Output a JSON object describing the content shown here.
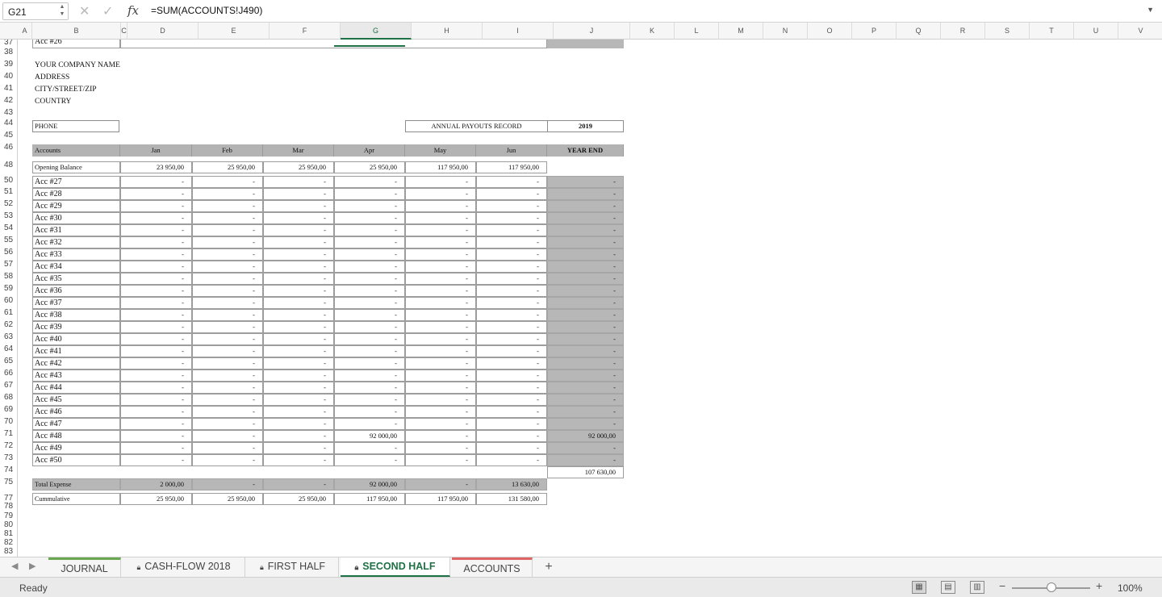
{
  "formula_bar": {
    "name_box": "G21",
    "cancel_icon": "✕",
    "enter_icon": "✓",
    "fx": "fx",
    "formula": "=SUM(ACCOUNTS!J490)",
    "expand_icon": "▼"
  },
  "columns": [
    "A",
    "B",
    "C",
    "D",
    "E",
    "F",
    "G",
    "H",
    "I",
    "J",
    "K",
    "L",
    "M",
    "N",
    "O",
    "P",
    "Q",
    "R",
    "S",
    "T",
    "U",
    "V"
  ],
  "selected_column": "G",
  "rows": [
    "37",
    "38",
    "39",
    "40",
    "41",
    "42",
    "43",
    "44",
    "45",
    "46",
    "",
    "48",
    "",
    "50",
    "51",
    "52",
    "53",
    "54",
    "55",
    "56",
    "57",
    "58",
    "59",
    "60",
    "61",
    "62",
    "63",
    "64",
    "65",
    "66",
    "67",
    "68",
    "69",
    "70",
    "71",
    "72",
    "73",
    "74",
    "75",
    "",
    "77",
    "78",
    "79",
    "80",
    "81",
    "82",
    "83"
  ],
  "sheet": {
    "top_row_label": "Acc #26",
    "company": [
      "YOUR COMPANY NAME",
      "ADDRESS",
      "CITY/STREET/ZIP",
      "COUNTRY"
    ],
    "phone_label": "PHONE",
    "record_title": "ANNUAL PAYOUTS RECORD",
    "year": "2019",
    "header": [
      "Accounts",
      "Jan",
      "Feb",
      "Mar",
      "Apr",
      "May",
      "Jun",
      "YEAR END"
    ],
    "opening_balance": {
      "label": "Opening Balance",
      "values": [
        "23 950,00",
        "25 950,00",
        "25 950,00",
        "25 950,00",
        "117 950,00",
        "117 950,00"
      ]
    },
    "accounts": [
      {
        "label": "Acc #27",
        "values": [
          "-",
          "-",
          "-",
          "-",
          "-",
          "-",
          "-"
        ]
      },
      {
        "label": "Acc #28",
        "values": [
          "-",
          "-",
          "-",
          "-",
          "-",
          "-",
          "-"
        ]
      },
      {
        "label": "Acc #29",
        "values": [
          "-",
          "-",
          "-",
          "-",
          "-",
          "-",
          "-"
        ]
      },
      {
        "label": "Acc #30",
        "values": [
          "-",
          "-",
          "-",
          "-",
          "-",
          "-",
          "-"
        ]
      },
      {
        "label": "Acc #31",
        "values": [
          "-",
          "-",
          "-",
          "-",
          "-",
          "-",
          "-"
        ]
      },
      {
        "label": "Acc #32",
        "values": [
          "-",
          "-",
          "-",
          "-",
          "-",
          "-",
          "-"
        ]
      },
      {
        "label": "Acc #33",
        "values": [
          "-",
          "-",
          "-",
          "-",
          "-",
          "-",
          "-"
        ]
      },
      {
        "label": "Acc #34",
        "values": [
          "-",
          "-",
          "-",
          "-",
          "-",
          "-",
          "-"
        ]
      },
      {
        "label": "Acc #35",
        "values": [
          "-",
          "-",
          "-",
          "-",
          "-",
          "-",
          "-"
        ]
      },
      {
        "label": "Acc #36",
        "values": [
          "-",
          "-",
          "-",
          "-",
          "-",
          "-",
          "-"
        ]
      },
      {
        "label": "Acc #37",
        "values": [
          "-",
          "-",
          "-",
          "-",
          "-",
          "-",
          "-"
        ]
      },
      {
        "label": "Acc #38",
        "values": [
          "-",
          "-",
          "-",
          "-",
          "-",
          "-",
          "-"
        ]
      },
      {
        "label": "Acc #39",
        "values": [
          "-",
          "-",
          "-",
          "-",
          "-",
          "-",
          "-"
        ]
      },
      {
        "label": "Acc #40",
        "values": [
          "-",
          "-",
          "-",
          "-",
          "-",
          "-",
          "-"
        ]
      },
      {
        "label": "Acc #41",
        "values": [
          "-",
          "-",
          "-",
          "-",
          "-",
          "-",
          "-"
        ]
      },
      {
        "label": "Acc #42",
        "values": [
          "-",
          "-",
          "-",
          "-",
          "-",
          "-",
          "-"
        ]
      },
      {
        "label": "Acc #43",
        "values": [
          "-",
          "-",
          "-",
          "-",
          "-",
          "-",
          "-"
        ]
      },
      {
        "label": "Acc #44",
        "values": [
          "-",
          "-",
          "-",
          "-",
          "-",
          "-",
          "-"
        ]
      },
      {
        "label": "Acc #45",
        "values": [
          "-",
          "-",
          "-",
          "-",
          "-",
          "-",
          "-"
        ]
      },
      {
        "label": "Acc #46",
        "values": [
          "-",
          "-",
          "-",
          "-",
          "-",
          "-",
          "-"
        ]
      },
      {
        "label": "Acc #47",
        "values": [
          "-",
          "-",
          "-",
          "-",
          "-",
          "-",
          "-"
        ]
      },
      {
        "label": "Acc #48",
        "values": [
          "-",
          "-",
          "-",
          "92 000,00",
          "-",
          "-",
          "92 000,00"
        ]
      },
      {
        "label": "Acc #49",
        "values": [
          "-",
          "-",
          "-",
          "-",
          "-",
          "-",
          "-"
        ]
      },
      {
        "label": "Acc #50",
        "values": [
          "-",
          "-",
          "-",
          "-",
          "-",
          "-",
          "-"
        ]
      }
    ],
    "year_end_total": "107 630,00",
    "total_expense": {
      "label": "Total Expense",
      "values": [
        "2 000,00",
        "-",
        "-",
        "92 000,00",
        "-",
        "13 630,00"
      ]
    },
    "cumulative": {
      "label": "Cummulative",
      "values": [
        "25 950,00",
        "25 950,00",
        "25 950,00",
        "117 950,00",
        "117 950,00",
        "131 580,00"
      ]
    }
  },
  "tabs": [
    {
      "label": "JOURNAL",
      "locked": false,
      "active": false,
      "accent": "#6aa84f"
    },
    {
      "label": "CASH-FLOW 2018",
      "locked": true,
      "active": false,
      "accent": ""
    },
    {
      "label": "FIRST HALF",
      "locked": true,
      "active": false,
      "accent": ""
    },
    {
      "label": "SECOND HALF",
      "locked": true,
      "active": true,
      "accent": "#1e7145"
    },
    {
      "label": "ACCOUNTS",
      "locked": false,
      "active": false,
      "accent": "#e06666"
    }
  ],
  "tab_nav": {
    "prev": "◀",
    "next": "▶",
    "add": "+"
  },
  "status": {
    "text": "Ready",
    "zoom": "100%",
    "zoom_minus": "−",
    "zoom_plus": "+",
    "zoom_fraction": 0.5
  }
}
